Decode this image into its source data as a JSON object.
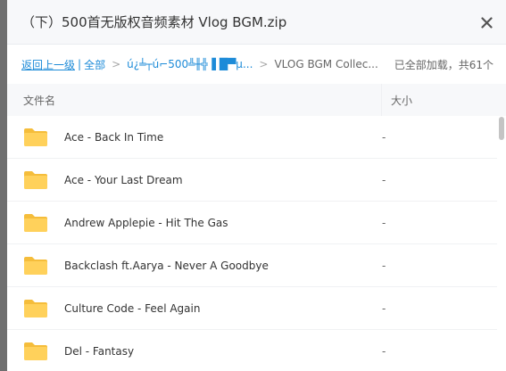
{
  "dialog": {
    "title": "（下）500首无版权音频素材 Vlog BGM.zip"
  },
  "path": {
    "back_label": "返回上一级",
    "separator": "|",
    "all_label": "全部",
    "arrow": ">",
    "folder1_label": "ú¿╧┬ú⌐500╩╫╬▐ █▀µ...",
    "folder2_label": "VLOG BGM Collec...",
    "loaded_status": "已全部加载，共61个"
  },
  "columns": {
    "name": "文件名",
    "size": "大小"
  },
  "files": [
    {
      "name": "Ace - Back In Time",
      "size": "-"
    },
    {
      "name": "Ace - Your Last Dream",
      "size": "-"
    },
    {
      "name": "Andrew Applepie - Hit The Gas",
      "size": "-"
    },
    {
      "name": "Backclash ft.Aarya - Never A Goodbye",
      "size": "-"
    },
    {
      "name": "Culture Code - Feel Again",
      "size": "-"
    },
    {
      "name": "Del - Fantasy",
      "size": "-"
    }
  ],
  "colors": {
    "folder": "#ffd15b",
    "folder_dark": "#f5bd3b",
    "link": "#1d8bd8"
  }
}
